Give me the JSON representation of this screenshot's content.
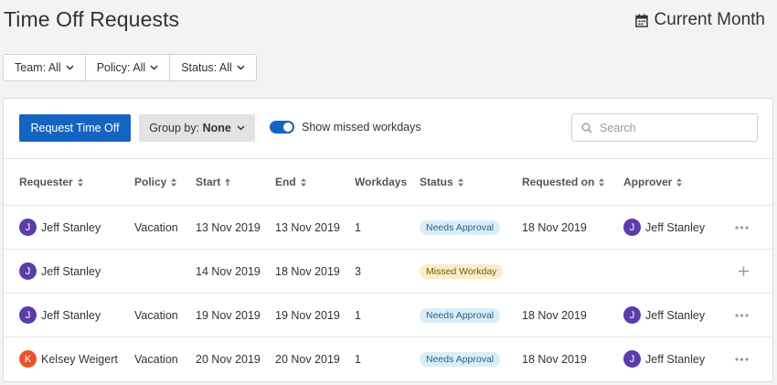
{
  "header": {
    "title": "Time Off Requests",
    "period_label": "Current Month",
    "period_icon": "calendar-icon"
  },
  "filters": [
    {
      "label": "Team: All",
      "icon": "chevron-down-icon"
    },
    {
      "label": "Policy: All",
      "icon": "chevron-down-icon"
    },
    {
      "label": "Status: All",
      "icon": "chevron-down-icon"
    }
  ],
  "toolbar": {
    "request_button_label": "Request Time Off",
    "group_by_prefix": "Group by:",
    "group_by_value": "None",
    "toggle_label": "Show missed workdays",
    "toggle_on": true,
    "search_placeholder": "Search",
    "search_value": ""
  },
  "table": {
    "columns": [
      {
        "label": "Requester",
        "sort": "both"
      },
      {
        "label": "Policy",
        "sort": "both"
      },
      {
        "label": "Start",
        "sort": "asc"
      },
      {
        "label": "End",
        "sort": "both"
      },
      {
        "label": "Workdays",
        "sort": "none"
      },
      {
        "label": "Status",
        "sort": "both"
      },
      {
        "label": "Requested on",
        "sort": "both"
      },
      {
        "label": "Approver",
        "sort": "both"
      }
    ],
    "rows": [
      {
        "requester": "Jeff Stanley",
        "requester_initial": "J",
        "requester_color": "#5b3ca8",
        "policy": "Vacation",
        "start": "13 Nov 2019",
        "end": "13 Nov 2019",
        "workdays": "1",
        "status": "Needs Approval",
        "status_type": "needs-approval",
        "requested_on": "18 Nov 2019",
        "approver": "Jeff Stanley",
        "approver_initial": "J",
        "approver_color": "#5b3ca8",
        "action": "more"
      },
      {
        "requester": "Jeff Stanley",
        "requester_initial": "J",
        "requester_color": "#5b3ca8",
        "policy": "",
        "start": "14 Nov 2019",
        "end": "18 Nov 2019",
        "workdays": "3",
        "status": "Missed Workday",
        "status_type": "missed",
        "requested_on": "",
        "approver": "",
        "approver_initial": "",
        "approver_color": "",
        "action": "add"
      },
      {
        "requester": "Jeff Stanley",
        "requester_initial": "J",
        "requester_color": "#5b3ca8",
        "policy": "Vacation",
        "start": "19 Nov 2019",
        "end": "19 Nov 2019",
        "workdays": "1",
        "status": "Needs Approval",
        "status_type": "needs-approval",
        "requested_on": "18 Nov 2019",
        "approver": "Jeff Stanley",
        "approver_initial": "J",
        "approver_color": "#5b3ca8",
        "action": "more"
      },
      {
        "requester": "Kelsey Weigert",
        "requester_initial": "K",
        "requester_color": "#e8552b",
        "policy": "Vacation",
        "start": "20 Nov 2019",
        "end": "20 Nov 2019",
        "workdays": "1",
        "status": "Needs Approval",
        "status_type": "needs-approval",
        "requested_on": "18 Nov 2019",
        "approver": "Jeff Stanley",
        "approver_initial": "J",
        "approver_color": "#5b3ca8",
        "action": "more"
      }
    ]
  },
  "colors": {
    "primary": "#1565c0",
    "needs_approval_bg": "#d8eef9",
    "needs_approval_text": "#2c5f80",
    "missed_bg": "#fbecc5",
    "missed_text": "#7a5a10"
  }
}
